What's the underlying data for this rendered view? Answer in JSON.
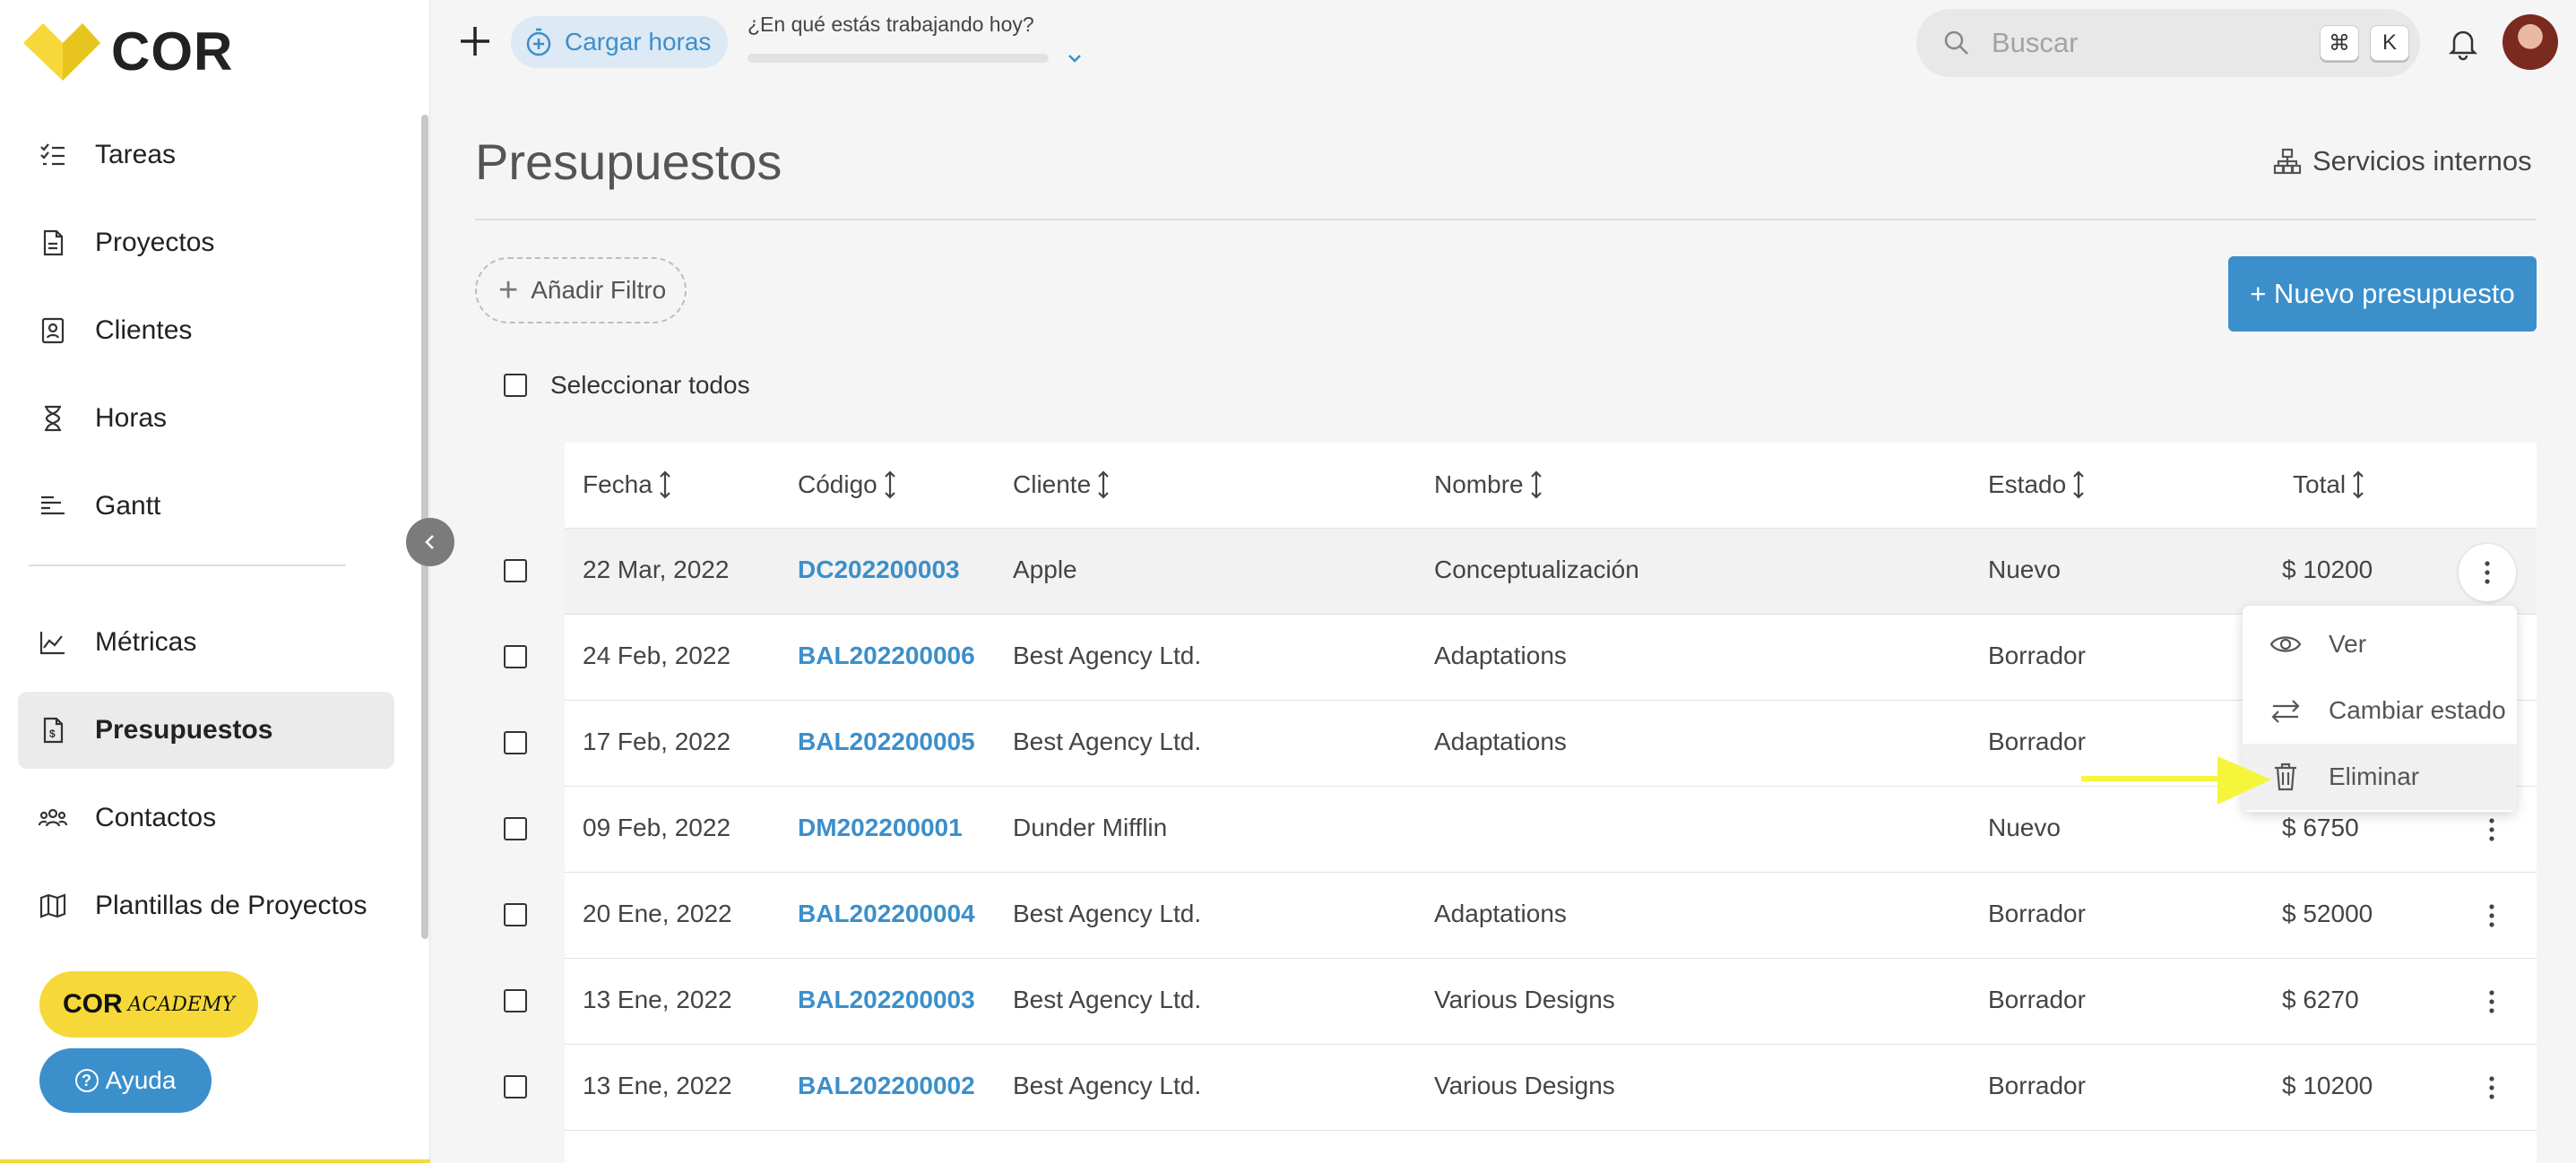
{
  "brand": {
    "name": "COR",
    "logo_color": "#f6d938"
  },
  "sidebar": {
    "items": [
      {
        "label": "Tareas",
        "icon": "task-list-icon"
      },
      {
        "label": "Proyectos",
        "icon": "project-doc-icon"
      },
      {
        "label": "Clientes",
        "icon": "client-card-icon"
      },
      {
        "label": "Horas",
        "icon": "hourglass-icon"
      },
      {
        "label": "Gantt",
        "icon": "gantt-icon"
      },
      {
        "label": "Métricas",
        "icon": "metrics-icon"
      },
      {
        "label": "Presupuestos",
        "icon": "budget-icon",
        "active": true
      },
      {
        "label": "Contactos",
        "icon": "contacts-icon"
      },
      {
        "label": "Plantillas de Proyectos",
        "icon": "template-map-icon"
      }
    ],
    "academy_main": "COR",
    "academy_sub": "ACADEMY",
    "help_label": "Ayuda"
  },
  "topbar": {
    "hours_label": "Cargar horas",
    "working_prompt": "¿En qué estás trabajando hoy?",
    "search_placeholder": "Buscar",
    "shortcut_key1": "⌘",
    "shortcut_key2": "K"
  },
  "page": {
    "title": "Presupuestos",
    "internal_services": "Servicios internos",
    "add_filter": "Añadir Filtro",
    "new_budget": "+ Nuevo presupuesto",
    "select_all": "Seleccionar todos"
  },
  "table": {
    "headers": [
      "Fecha",
      "Código",
      "Cliente",
      "Nombre",
      "Estado",
      "Total"
    ],
    "rows": [
      {
        "fecha": "22 Mar, 2022",
        "codigo": "DC202200003",
        "cliente": "Apple",
        "nombre": "Conceptualización",
        "estado": "Nuevo",
        "total": "$  10200"
      },
      {
        "fecha": "24 Feb, 2022",
        "codigo": "BAL202200006",
        "cliente": "Best Agency Ltd.",
        "nombre": "Adaptations",
        "estado": "Borrador",
        "total": ""
      },
      {
        "fecha": "17 Feb, 2022",
        "codigo": "BAL202200005",
        "cliente": "Best Agency Ltd.",
        "nombre": "Adaptations",
        "estado": "Borrador",
        "total": ""
      },
      {
        "fecha": "09 Feb, 2022",
        "codigo": "DM202200001",
        "cliente": "Dunder Mifflin",
        "nombre": "",
        "estado": "Nuevo",
        "total": "$  6750"
      },
      {
        "fecha": "20 Ene, 2022",
        "codigo": "BAL202200004",
        "cliente": "Best Agency Ltd.",
        "nombre": "Adaptations",
        "estado": "Borrador",
        "total": "$  52000"
      },
      {
        "fecha": "13 Ene, 2022",
        "codigo": "BAL202200003",
        "cliente": "Best Agency Ltd.",
        "nombre": "Various Designs",
        "estado": "Borrador",
        "total": "$  6270"
      },
      {
        "fecha": "13 Ene, 2022",
        "codigo": "BAL202200002",
        "cliente": "Best Agency Ltd.",
        "nombre": "Various Designs",
        "estado": "Borrador",
        "total": "$  10200"
      }
    ]
  },
  "context_menu": {
    "items": [
      {
        "label": "Ver",
        "icon": "eye-icon"
      },
      {
        "label": "Cambiar estado",
        "icon": "swap-arrows-icon"
      },
      {
        "label": "Eliminar",
        "icon": "trash-icon"
      }
    ]
  },
  "colors": {
    "accent": "#3b8fcb",
    "brand_yellow": "#f6d938",
    "annotation_arrow": "#f5f53c"
  }
}
